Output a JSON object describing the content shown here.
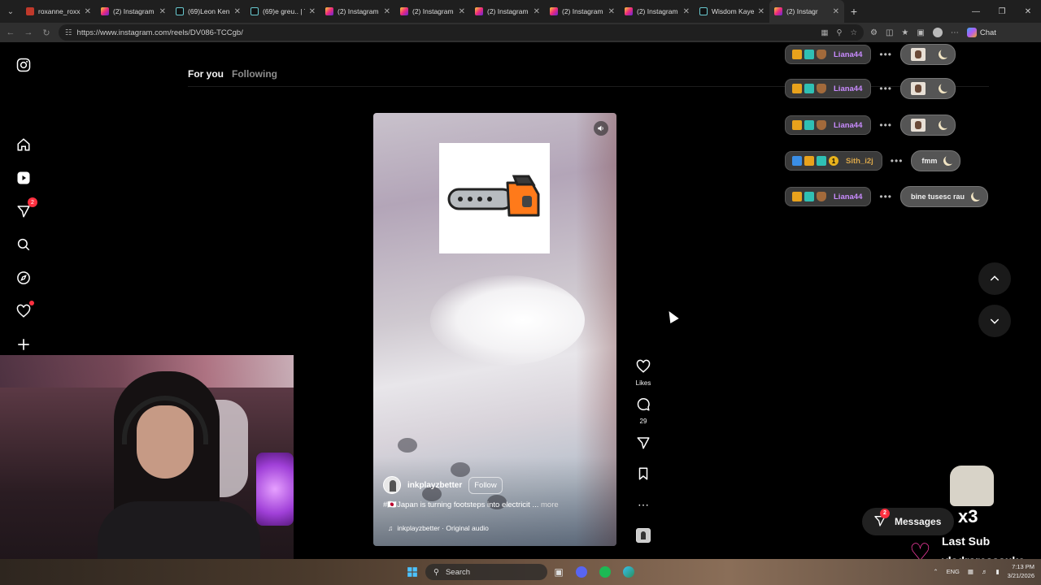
{
  "browser": {
    "tabs": [
      {
        "label": "roxanne_roxx d",
        "icon": "dribbble-icon"
      },
      {
        "label": "(2) Instagram",
        "icon": "instagram-icon"
      },
      {
        "label": "(69)Leon Kenne",
        "icon": "tiktok-icon"
      },
      {
        "label": "(69)e greu.. | Ti",
        "icon": "tiktok-icon"
      },
      {
        "label": "(2) Instagram",
        "icon": "instagram-icon"
      },
      {
        "label": "(2) Instagram",
        "icon": "instagram-icon"
      },
      {
        "label": "(2) Instagram",
        "icon": "instagram-icon"
      },
      {
        "label": "(2) Instagram",
        "icon": "instagram-icon"
      },
      {
        "label": "(2) Instagram",
        "icon": "instagram-icon"
      },
      {
        "label": "Wisdom Kaye",
        "icon": "tiktok-icon"
      },
      {
        "label": "(2) Instagr",
        "icon": "instagram-icon",
        "active": true
      }
    ],
    "url": "https://www.instagram.com/reels/DV086-TCCgb/",
    "chat_label": "Chat"
  },
  "instagram": {
    "sidebar_badge": "2",
    "feed_tabs": {
      "for_you": "For you",
      "following": "Following"
    },
    "reel": {
      "author": "inkplayzbetter",
      "follow_label": "Follow",
      "caption": "#🇯🇵Japan is turning footsteps into electricit ...",
      "more_label": "more",
      "audio": "inkplayzbetter · Original audio"
    },
    "actions": {
      "likes_label": "Likes",
      "comments_count": "29"
    },
    "messages": {
      "label": "Messages",
      "badge": "2"
    }
  },
  "stream_chat": [
    {
      "user": "Liana44",
      "badges": [
        "crown",
        "bits",
        "cup"
      ],
      "message": "",
      "emote": true,
      "color": "#c98bff"
    },
    {
      "user": "Liana44",
      "badges": [
        "crown",
        "bits",
        "cup"
      ],
      "message": "",
      "emote": true,
      "color": "#c98bff"
    },
    {
      "user": "Liana44",
      "badges": [
        "crown",
        "bits",
        "cup"
      ],
      "message": "",
      "emote": true,
      "color": "#c98bff"
    },
    {
      "user": "Sith_i2j",
      "badges": [
        "sword",
        "crown",
        "bits",
        "one"
      ],
      "message": "fmm",
      "emote": false,
      "color": "#d9a64a"
    },
    {
      "user": "Liana44",
      "badges": [
        "crown",
        "bits",
        "cup"
      ],
      "message": "bine tusesc rau",
      "emote": false,
      "color": "#c98bff"
    }
  ],
  "overlay": {
    "x3": "x3",
    "last_sub_title": "Last Sub",
    "last_sub_name": "vladraresasuke"
  },
  "taskbar": {
    "search_label": "Search",
    "lang": "ENG",
    "time": "7:13 PM",
    "date": "3/21/2026"
  }
}
